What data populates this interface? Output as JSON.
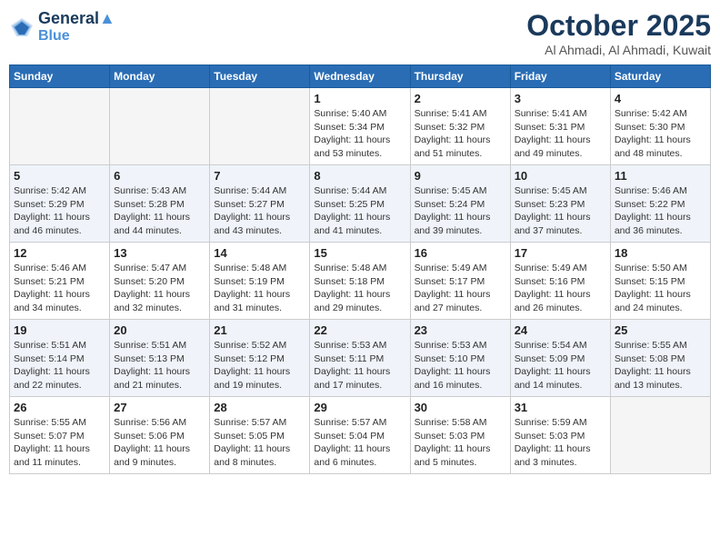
{
  "header": {
    "logo_line1": "General",
    "logo_line2": "Blue",
    "month": "October 2025",
    "location": "Al Ahmadi, Al Ahmadi, Kuwait"
  },
  "days_of_week": [
    "Sunday",
    "Monday",
    "Tuesday",
    "Wednesday",
    "Thursday",
    "Friday",
    "Saturday"
  ],
  "weeks": [
    [
      {
        "day": "",
        "info": ""
      },
      {
        "day": "",
        "info": ""
      },
      {
        "day": "",
        "info": ""
      },
      {
        "day": "1",
        "info": "Sunrise: 5:40 AM\nSunset: 5:34 PM\nDaylight: 11 hours\nand 53 minutes."
      },
      {
        "day": "2",
        "info": "Sunrise: 5:41 AM\nSunset: 5:32 PM\nDaylight: 11 hours\nand 51 minutes."
      },
      {
        "day": "3",
        "info": "Sunrise: 5:41 AM\nSunset: 5:31 PM\nDaylight: 11 hours\nand 49 minutes."
      },
      {
        "day": "4",
        "info": "Sunrise: 5:42 AM\nSunset: 5:30 PM\nDaylight: 11 hours\nand 48 minutes."
      }
    ],
    [
      {
        "day": "5",
        "info": "Sunrise: 5:42 AM\nSunset: 5:29 PM\nDaylight: 11 hours\nand 46 minutes."
      },
      {
        "day": "6",
        "info": "Sunrise: 5:43 AM\nSunset: 5:28 PM\nDaylight: 11 hours\nand 44 minutes."
      },
      {
        "day": "7",
        "info": "Sunrise: 5:44 AM\nSunset: 5:27 PM\nDaylight: 11 hours\nand 43 minutes."
      },
      {
        "day": "8",
        "info": "Sunrise: 5:44 AM\nSunset: 5:25 PM\nDaylight: 11 hours\nand 41 minutes."
      },
      {
        "day": "9",
        "info": "Sunrise: 5:45 AM\nSunset: 5:24 PM\nDaylight: 11 hours\nand 39 minutes."
      },
      {
        "day": "10",
        "info": "Sunrise: 5:45 AM\nSunset: 5:23 PM\nDaylight: 11 hours\nand 37 minutes."
      },
      {
        "day": "11",
        "info": "Sunrise: 5:46 AM\nSunset: 5:22 PM\nDaylight: 11 hours\nand 36 minutes."
      }
    ],
    [
      {
        "day": "12",
        "info": "Sunrise: 5:46 AM\nSunset: 5:21 PM\nDaylight: 11 hours\nand 34 minutes."
      },
      {
        "day": "13",
        "info": "Sunrise: 5:47 AM\nSunset: 5:20 PM\nDaylight: 11 hours\nand 32 minutes."
      },
      {
        "day": "14",
        "info": "Sunrise: 5:48 AM\nSunset: 5:19 PM\nDaylight: 11 hours\nand 31 minutes."
      },
      {
        "day": "15",
        "info": "Sunrise: 5:48 AM\nSunset: 5:18 PM\nDaylight: 11 hours\nand 29 minutes."
      },
      {
        "day": "16",
        "info": "Sunrise: 5:49 AM\nSunset: 5:17 PM\nDaylight: 11 hours\nand 27 minutes."
      },
      {
        "day": "17",
        "info": "Sunrise: 5:49 AM\nSunset: 5:16 PM\nDaylight: 11 hours\nand 26 minutes."
      },
      {
        "day": "18",
        "info": "Sunrise: 5:50 AM\nSunset: 5:15 PM\nDaylight: 11 hours\nand 24 minutes."
      }
    ],
    [
      {
        "day": "19",
        "info": "Sunrise: 5:51 AM\nSunset: 5:14 PM\nDaylight: 11 hours\nand 22 minutes."
      },
      {
        "day": "20",
        "info": "Sunrise: 5:51 AM\nSunset: 5:13 PM\nDaylight: 11 hours\nand 21 minutes."
      },
      {
        "day": "21",
        "info": "Sunrise: 5:52 AM\nSunset: 5:12 PM\nDaylight: 11 hours\nand 19 minutes."
      },
      {
        "day": "22",
        "info": "Sunrise: 5:53 AM\nSunset: 5:11 PM\nDaylight: 11 hours\nand 17 minutes."
      },
      {
        "day": "23",
        "info": "Sunrise: 5:53 AM\nSunset: 5:10 PM\nDaylight: 11 hours\nand 16 minutes."
      },
      {
        "day": "24",
        "info": "Sunrise: 5:54 AM\nSunset: 5:09 PM\nDaylight: 11 hours\nand 14 minutes."
      },
      {
        "day": "25",
        "info": "Sunrise: 5:55 AM\nSunset: 5:08 PM\nDaylight: 11 hours\nand 13 minutes."
      }
    ],
    [
      {
        "day": "26",
        "info": "Sunrise: 5:55 AM\nSunset: 5:07 PM\nDaylight: 11 hours\nand 11 minutes."
      },
      {
        "day": "27",
        "info": "Sunrise: 5:56 AM\nSunset: 5:06 PM\nDaylight: 11 hours\nand 9 minutes."
      },
      {
        "day": "28",
        "info": "Sunrise: 5:57 AM\nSunset: 5:05 PM\nDaylight: 11 hours\nand 8 minutes."
      },
      {
        "day": "29",
        "info": "Sunrise: 5:57 AM\nSunset: 5:04 PM\nDaylight: 11 hours\nand 6 minutes."
      },
      {
        "day": "30",
        "info": "Sunrise: 5:58 AM\nSunset: 5:03 PM\nDaylight: 11 hours\nand 5 minutes."
      },
      {
        "day": "31",
        "info": "Sunrise: 5:59 AM\nSunset: 5:03 PM\nDaylight: 11 hours\nand 3 minutes."
      },
      {
        "day": "",
        "info": ""
      }
    ]
  ]
}
